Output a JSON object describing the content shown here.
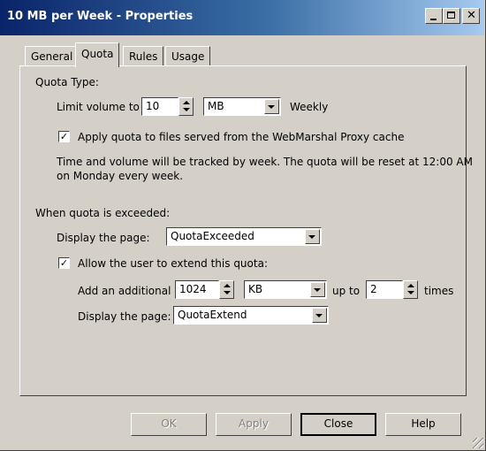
{
  "window": {
    "title": "10 MB per Week - Properties",
    "close_glyph": "✕"
  },
  "tabs": [
    {
      "label": "General"
    },
    {
      "label": "Quota"
    },
    {
      "label": "Rules"
    },
    {
      "label": "Usage"
    }
  ],
  "quota_type": {
    "heading": "Quota Type:",
    "limit_label": "Limit volume to",
    "limit_value": "10",
    "unit_value": "MB",
    "period": "Weekly",
    "apply_proxy_checked": true,
    "apply_proxy_label": "Apply quota to files served from the WebMarshal Proxy cache",
    "info_line1": "Time and volume will be tracked by week. The quota will be reset at 12:00 AM",
    "info_line2": "on Monday every week."
  },
  "exceeded": {
    "heading": "When quota is exceeded:",
    "display_page_label": "Display the page:",
    "display_page_value": "QuotaExceeded",
    "allow_extend_checked": true,
    "allow_extend_label": "Allow the user to extend this quota:",
    "add_label": "Add an additional",
    "add_value": "1024",
    "add_unit": "KB",
    "up_to_label": "up to",
    "up_to_value": "2",
    "times_label": "times",
    "extend_page_label": "Display the page:",
    "extend_page_value": "QuotaExtend"
  },
  "buttons": {
    "ok": "OK",
    "apply": "Apply",
    "close": "Close",
    "help": "Help"
  },
  "check_glyph": "✓"
}
